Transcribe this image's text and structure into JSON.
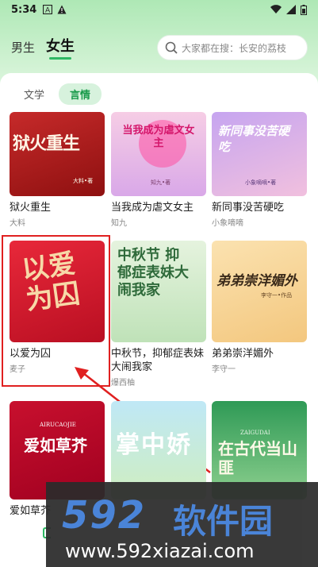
{
  "status_bar": {
    "time": "5:34"
  },
  "header": {
    "gender_tabs": [
      "男生",
      "女生"
    ],
    "search_placeholder": "大家都在搜：长安的荔枝"
  },
  "sub_tabs": [
    "文学",
    "言情"
  ],
  "books": [
    {
      "title": "狱火重生",
      "author": "大料",
      "cover_text": "狱火重生",
      "cover_small": "大料•著"
    },
    {
      "title": "当我成为虐文女主",
      "author": "知九",
      "cover_text": "当我成为虐文女主",
      "cover_small": "知九•著"
    },
    {
      "title": "新同事没苦硬吃",
      "author": "小象嘀嘀",
      "cover_text": "新同事没苦硬吃",
      "cover_small": "小象嘀嘀•著"
    },
    {
      "title": "以爱为囚",
      "author": "麦子",
      "cover_text": "以爱为囚",
      "cover_small": ""
    },
    {
      "title": "中秋节，抑郁症表妹大闹我家",
      "author": "爆西柚",
      "cover_text": "中秋节 抑郁症表妹大闹我家",
      "cover_small": ""
    },
    {
      "title": "弟弟崇洋媚外",
      "author": "李守一",
      "cover_text": "弟弟崇洋媚外",
      "cover_small": "李守一•作品"
    },
    {
      "title": "爱如草芥",
      "author": "",
      "cover_text": "爱如草芥",
      "cover_small": "AIRUCAOJIE"
    },
    {
      "title": "",
      "author": "",
      "cover_text": "掌中娇",
      "cover_small": ""
    },
    {
      "title": "",
      "author": "",
      "cover_text": "在古代当山匪",
      "cover_small": "ZAIGUDAI"
    }
  ],
  "watermark": {
    "logo": "592",
    "name": "软件园",
    "url": "www.592xiazai.com"
  },
  "colors": {
    "accent": "#2fb864",
    "highlight": "#e02020",
    "watermark_blue": "#3d7bd6"
  }
}
